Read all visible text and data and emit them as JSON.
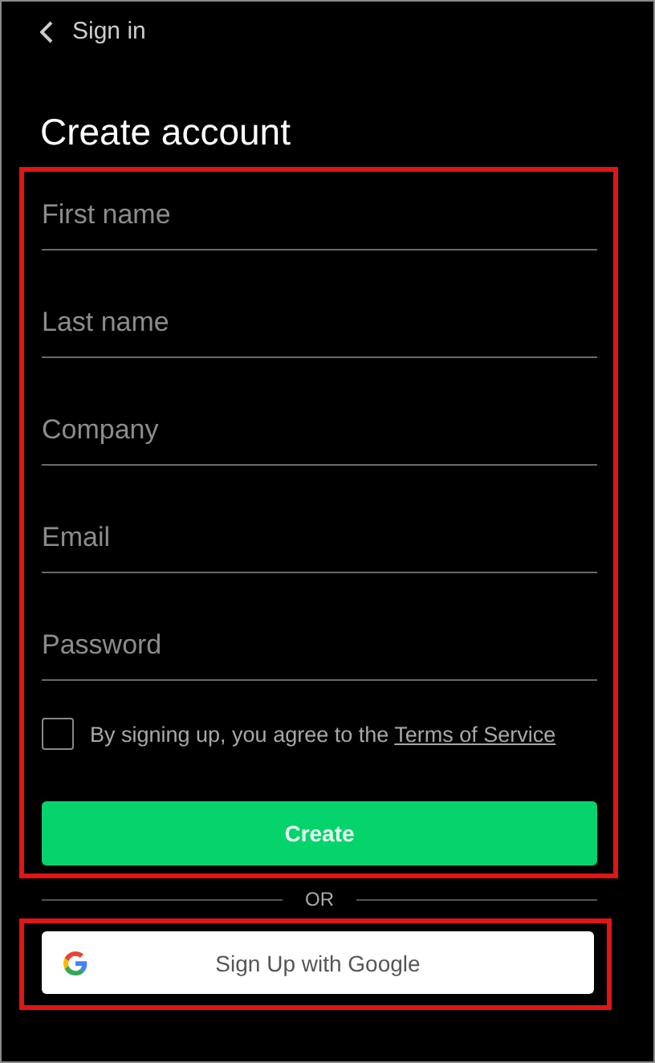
{
  "header": {
    "back_label": "Sign in"
  },
  "title": "Create account",
  "fields": [
    {
      "placeholder": "First name"
    },
    {
      "placeholder": "Last name"
    },
    {
      "placeholder": "Company"
    },
    {
      "placeholder": "Email"
    },
    {
      "placeholder": "Password"
    }
  ],
  "agreement": {
    "checked": false,
    "text": "By signing up, you agree to the",
    "link": "Terms of Service"
  },
  "create_button": "Create",
  "divider": "OR",
  "google_button": "Sign Up with Google"
}
